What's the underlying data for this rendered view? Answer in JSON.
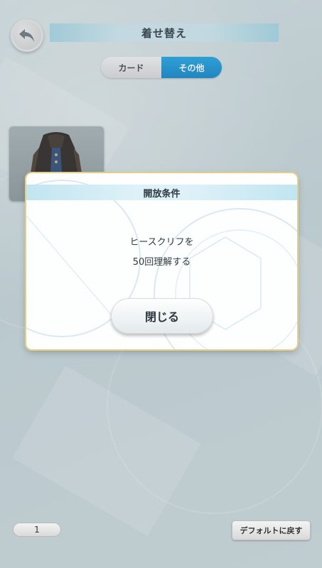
{
  "header": {
    "title": "着せ替え",
    "back_icon": "back-arrow-icon"
  },
  "tabs": [
    {
      "label": "カード",
      "active": false
    },
    {
      "label": "その他",
      "active": true
    }
  ],
  "costume": {
    "icon": "costume-coat-icon"
  },
  "modal": {
    "title": "開放条件",
    "message_line1": "ヒースクリフを",
    "message_line2": "50回理解する",
    "close_label": "閉じる"
  },
  "footer": {
    "page": "1",
    "default_label": "デフォルトに戻す"
  },
  "colors": {
    "accent": "#1495d8",
    "modal_border": "#e4cf86"
  }
}
